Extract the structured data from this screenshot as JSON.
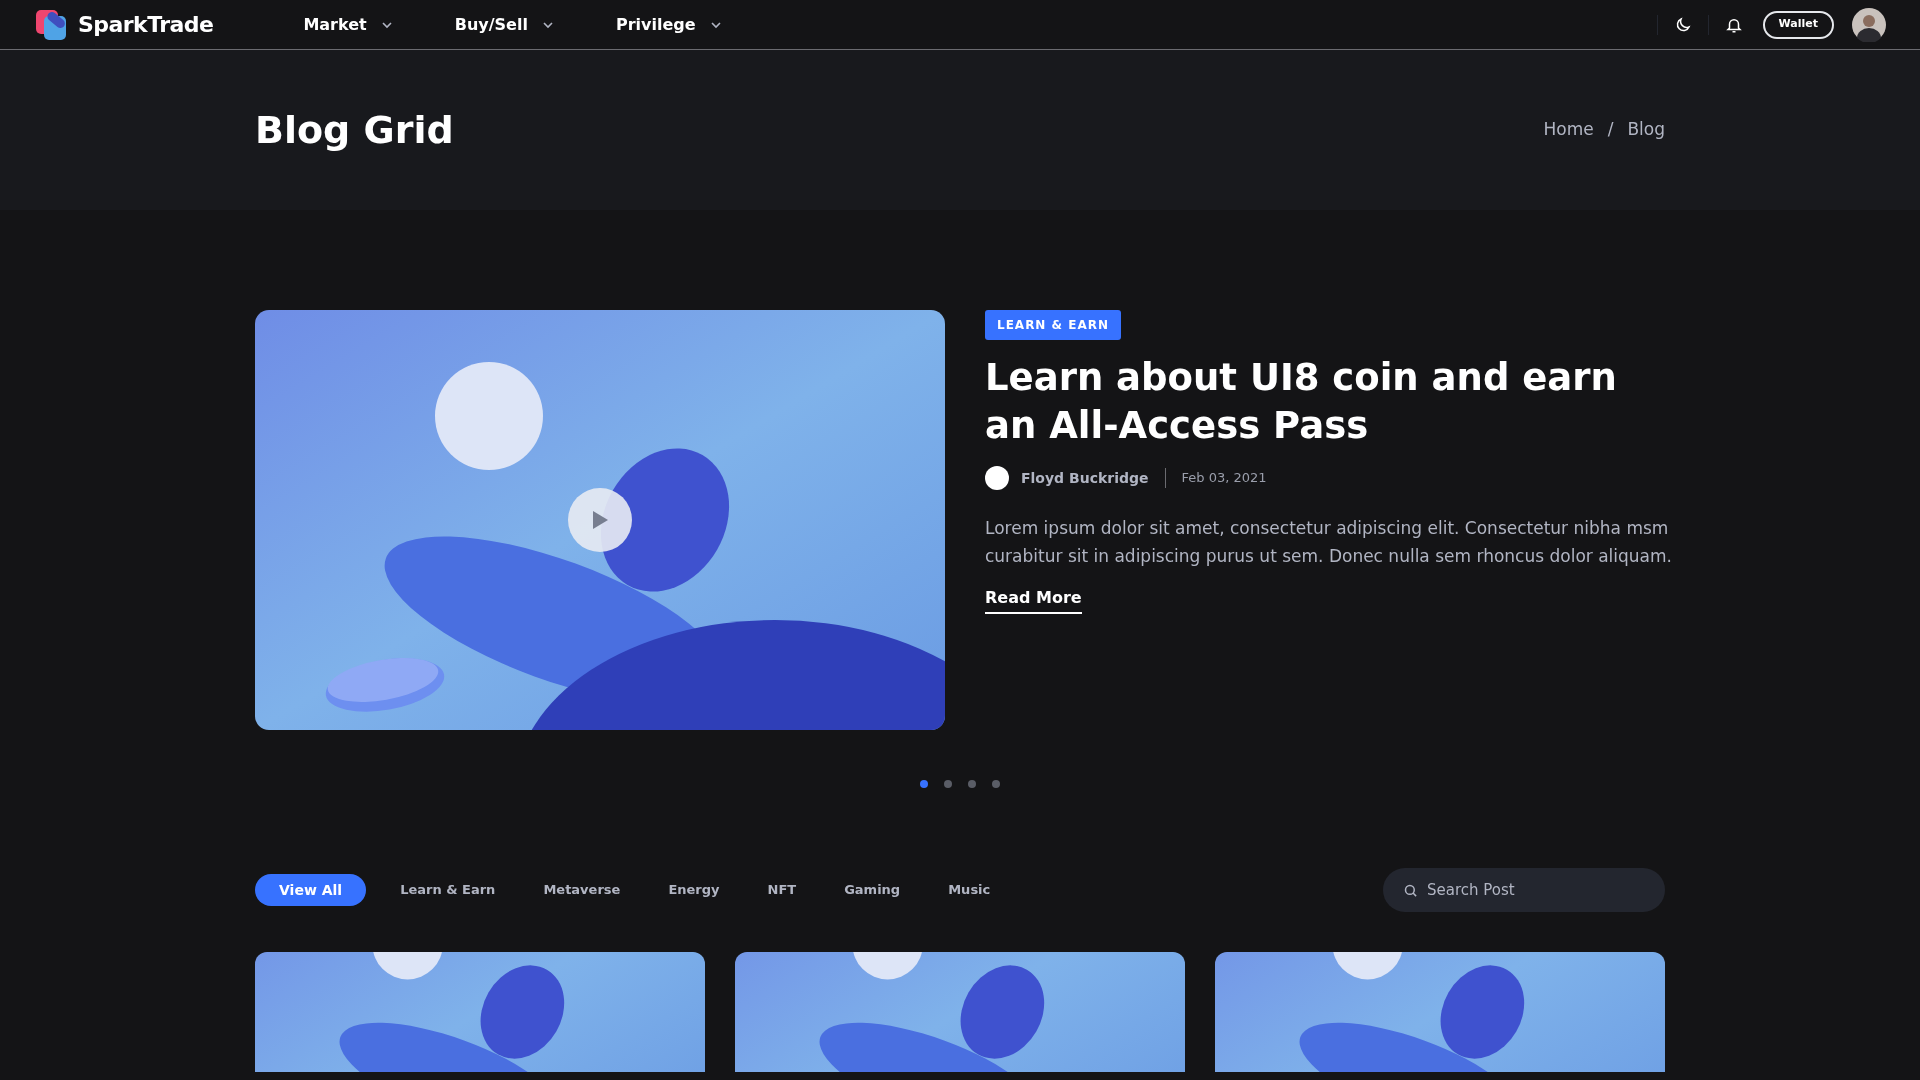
{
  "nav": {
    "brand": "SparkTrade",
    "menus": [
      {
        "label": "Market"
      },
      {
        "label": "Buy/Sell"
      },
      {
        "label": "Privilege"
      }
    ],
    "wallet": "Wallet"
  },
  "page_header": {
    "title": "Blog Grid",
    "breadcrumb": [
      "Home",
      "/",
      "Blog"
    ]
  },
  "featured": {
    "tag": "LEARN & EARN",
    "title": "Learn about UI8 coin and earn an All-Access Pass",
    "author": "Floyd Buckridge",
    "date": "Feb 03, 2021",
    "excerpt": "Lorem ipsum dolor sit amet, consectetur adipiscing elit. Consectetur nibha msm curabitur sit in adipiscing purus ut sem. Donec nulla sem rhoncus dolor aliquam.",
    "link": "Read More"
  },
  "slider_dots": [
    {
      "selected": true
    },
    {
      "selected": false
    },
    {
      "selected": false
    },
    {
      "selected": false
    }
  ],
  "filters": [
    {
      "label": "View All",
      "selected": true
    },
    {
      "label": "Learn & Earn",
      "selected": false
    },
    {
      "label": "Metaverse",
      "selected": false
    },
    {
      "label": "Energy",
      "selected": false
    },
    {
      "label": "NFT",
      "selected": false
    },
    {
      "label": "Gaming",
      "selected": false
    },
    {
      "label": "Music",
      "selected": false
    }
  ],
  "search": {
    "placeholder": "Search Post"
  }
}
